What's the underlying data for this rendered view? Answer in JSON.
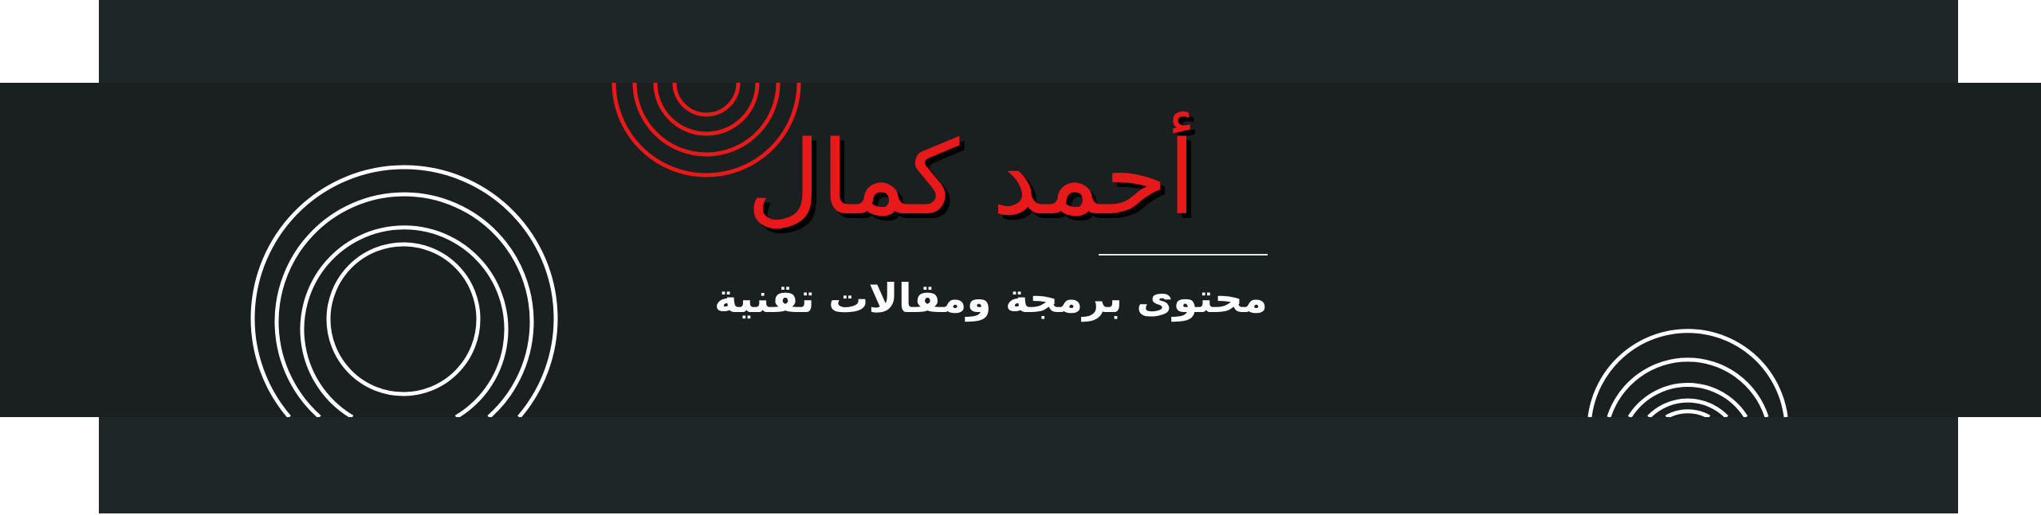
{
  "header": {
    "title": "أحمد كمال",
    "subtitle": "محتوى برمجة ومقالات تقنية"
  },
  "colors": {
    "outer_band": "#1d2728",
    "inner_band": "#1a1f1f",
    "accent": "#e8191a",
    "text": "#ffffff",
    "page_background": "#ffffff"
  },
  "decorations": [
    {
      "name": "red-concentric-arcs",
      "color": "#e8191a",
      "rings": 3
    },
    {
      "name": "white-concentric-circles",
      "color": "#ffffff",
      "rings": 4
    },
    {
      "name": "white-concentric-arcs",
      "color": "#ffffff",
      "rings": 4
    }
  ]
}
